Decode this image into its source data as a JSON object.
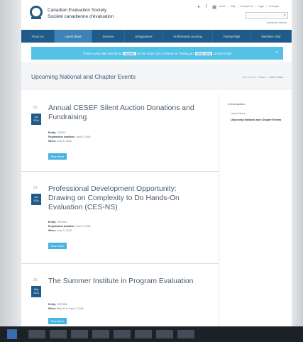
{
  "header": {
    "org_name_en": "Canadian Evaluation Society",
    "org_name_fr": "Société canadienne d'évaluation",
    "social": [
      "twitter-icon",
      "facebook-icon",
      "linkedin-icon"
    ],
    "utility_links": [
      "Home",
      "FAQ",
      "Contact Us",
      "Login",
      "Français"
    ],
    "search_placeholder": "",
    "advanced_search": "Advanced search"
  },
  "nav": {
    "items": [
      "About Us",
      "Latest News",
      "Services",
      "Designations",
      "Professional Learning",
      "Partnerships",
      "Members Only"
    ],
    "active": "Latest News"
  },
  "banner": {
    "text_before": "There is very little time left to",
    "link1": "register",
    "text_middle": "for the 2016 CES Conference. Finding an",
    "link2": "hotel room",
    "text_after": "can be tricky!",
    "close": "×"
  },
  "page": {
    "title": "Upcoming National and Chapter Events",
    "breadcrumb_label": "You are here:",
    "breadcrumb_home": "Home",
    "breadcrumb_sep": "/",
    "breadcrumb_current": "Latest News"
  },
  "events": [
    {
      "day": "05",
      "month": "Jun",
      "year": "2016",
      "title": "Annual CESEF Silent Auction Donations and Fundraising",
      "entity_label": "Entity:",
      "entity": "CESEF",
      "deadline_label": "Registration deadline:",
      "deadline": "June 5, 2016",
      "when_label": "When:",
      "when": "June 5, 2016",
      "button": "Read More"
    },
    {
      "day": "03",
      "month": "Jun",
      "year": "2016",
      "title": "Professional Development Opportunity: Drawing on Complexity to Do Hands-On Evaluation (CES-NS)",
      "entity_label": "Entity:",
      "entity": "CES-NS",
      "deadline_label": "Registration deadline:",
      "deadline": "June 3, 2016",
      "when_label": "When:",
      "when": "June 3, 2016",
      "button": "Read More"
    },
    {
      "day": "30",
      "month": "May",
      "year": "2016",
      "title": "The Summer Institute in Program Evaluation",
      "entity_label": "Entity:",
      "entity": "CES-MB",
      "when_label": "When:",
      "when": "May 30 to June 3, 2016",
      "button": "Read More"
    }
  ],
  "sidebar": {
    "heading": "In this section",
    "items": [
      "Latest News",
      "Upcoming National and Chapter Events"
    ]
  },
  "colors": {
    "nav": "#1f5a88",
    "nav_active": "#3e82b6",
    "banner": "#54c2e6",
    "button": "#48b3e2"
  }
}
